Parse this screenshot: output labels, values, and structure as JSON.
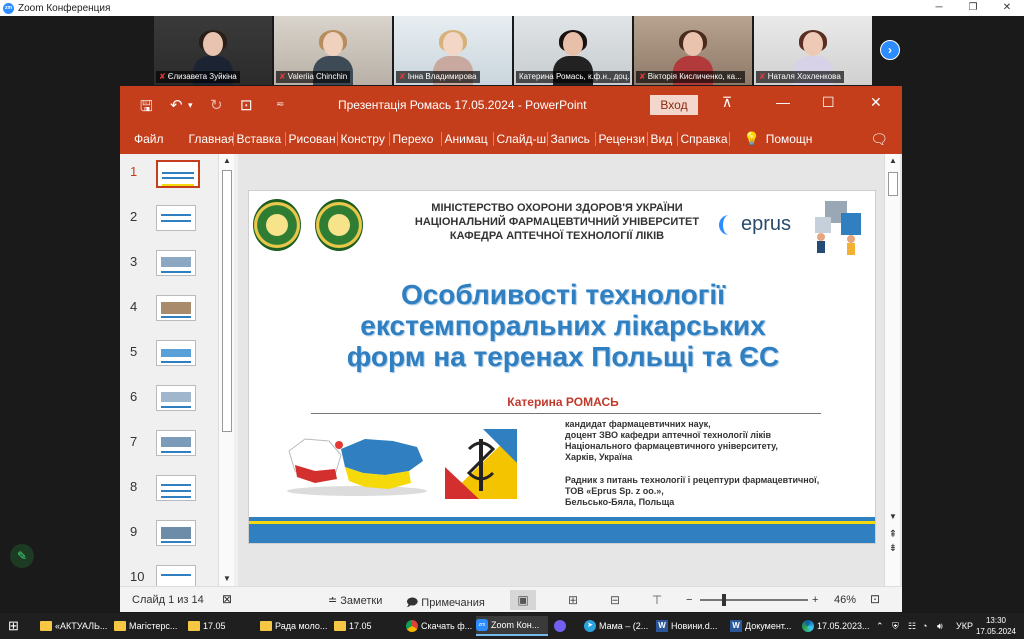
{
  "zoom": {
    "window_title": "Zoom Конференция",
    "participants": [
      {
        "name": "Єлизавета Зуйкіна"
      },
      {
        "name": "Valeriia Chinchin"
      },
      {
        "name": "Інна Владимирова"
      },
      {
        "name": "Катерина Ромась, к.ф.н., доц..."
      },
      {
        "name": "Вікторія Кисличенко, ка..."
      },
      {
        "name": "Наталя Хохленкова"
      }
    ],
    "next_icon": "chevron-right-icon"
  },
  "ppt": {
    "title": "Презентація Ромась 17.05.2024  -  PowerPoint",
    "signin": "Вход",
    "ribbon_tabs": [
      "Файл",
      "Главная",
      "Вставка",
      "Рисован",
      "Констру",
      "Перехо",
      "Анимац",
      "Слайд-ш",
      "Запись",
      "Рецензи",
      "Вид",
      "Справка"
    ],
    "help": "Помощн",
    "thumbnails": [
      "1",
      "2",
      "3",
      "4",
      "5",
      "6",
      "7",
      "8",
      "9",
      "10"
    ],
    "active_slide": "1",
    "status": {
      "slide_counter": "Слайд 1 из 14",
      "notes": "Заметки",
      "comments": "Примечания",
      "zoom_minus": "−",
      "zoom_plus": "+",
      "zoom_value": "46%",
      "zoom_level_percent": 46
    }
  },
  "slide": {
    "ministry_lines": [
      "МІНІСТЕРСТВО ОХОРОНИ ЗДОРОВ'Я УКРАЇНИ",
      "НАЦІОНАЛЬНИЙ ФАРМАЦЕВТИЧНИЙ УНІВЕРСИТЕТ",
      "КАФЕДРА АПТЕЧНОЇ ТЕХНОЛОГІЇ ЛІКІВ"
    ],
    "eprus_logo": "eprus",
    "title_lines": [
      "Особливості технології",
      "екстемпоральних лікарських",
      "форм на теренах Польщі та ЄС"
    ],
    "author": "Катерина РОМАСЬ",
    "bio_lines_1": [
      "кандидат фармацевтичних наук,",
      "доцент ЗВО кафедри аптечної технології ліків",
      "Національного фармацевтичного університету,",
      "Харків, Україна"
    ],
    "bio_lines_2": [
      "Радник з питань технології і рецептури фармацевтичної,",
      "ТОВ «Eprus Sp. z oo.»,",
      "Бельсько-Бяла, Польща"
    ],
    "colors": {
      "title": "#2f7fc1",
      "author": "#c0392b",
      "stripe_yellow": "#f5d90a",
      "stripe_blue": "#2f7fc1"
    }
  },
  "taskbar": {
    "items": [
      "«АКТУАЛЬ...",
      "Магістерс...",
      "17.05",
      "Рада моло...",
      "17.05",
      "Скачать ф...",
      "Zoom Кон...",
      "",
      "Мама – (2...",
      "Новини.d...",
      "Документ...",
      "17.05.2023..."
    ],
    "lang": "УКР",
    "time": "13:30",
    "date": "17.05.2024"
  }
}
